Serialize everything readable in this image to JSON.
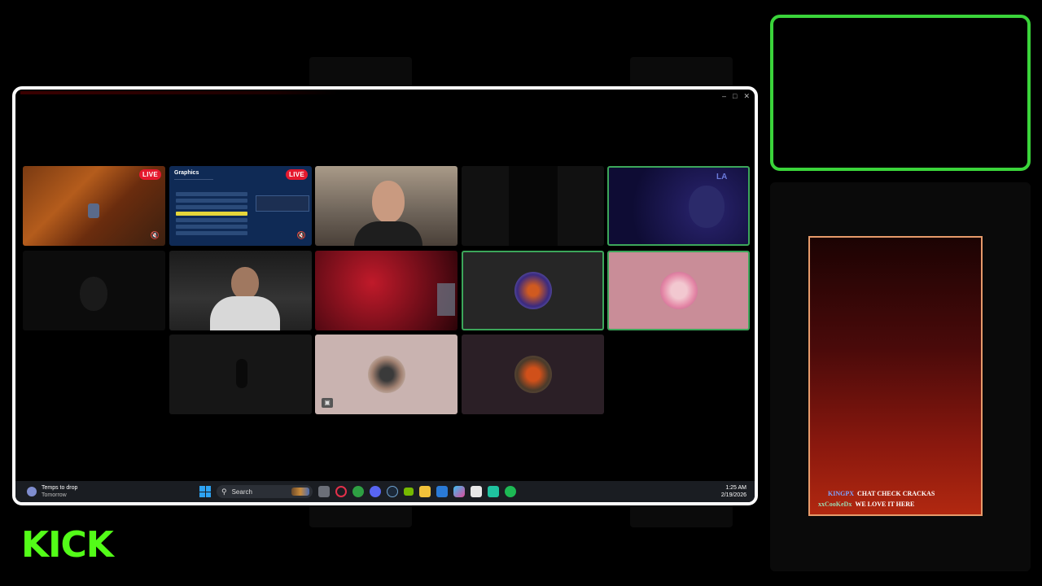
{
  "brand": {
    "logo_text": "KICK",
    "accent": "#53fc18"
  },
  "call_grid": {
    "tiles": [
      {
        "id": "gameplay",
        "live_badge": "LIVE"
      },
      {
        "id": "graphics-settings",
        "live_badge": "LIVE",
        "title": "Graphics"
      },
      {
        "id": "webcam-bald-man"
      },
      {
        "id": "dark-empty"
      },
      {
        "id": "blue-cap-user",
        "speaking": true
      },
      {
        "id": "dark-hooded"
      },
      {
        "id": "webcam-headset"
      },
      {
        "id": "red-room"
      },
      {
        "id": "avatar-circle",
        "speaking": true
      },
      {
        "id": "pink-avatar",
        "speaking": true
      },
      {
        "id": "dark-figure"
      },
      {
        "id": "beige-avatar"
      },
      {
        "id": "purple-avatar"
      }
    ]
  },
  "taskbar": {
    "weather_title": "Temps to drop",
    "weather_sub": "Tomorrow",
    "search_label": "Search",
    "time": "1:25 AM",
    "date": "2/19/2026"
  },
  "chat": {
    "messages": [
      {
        "user": "KINGPX",
        "text": "CHAT CHECK CRACKAS"
      },
      {
        "user": "xxCooKeDx",
        "text": "WE LOVE IT HERE"
      }
    ]
  }
}
